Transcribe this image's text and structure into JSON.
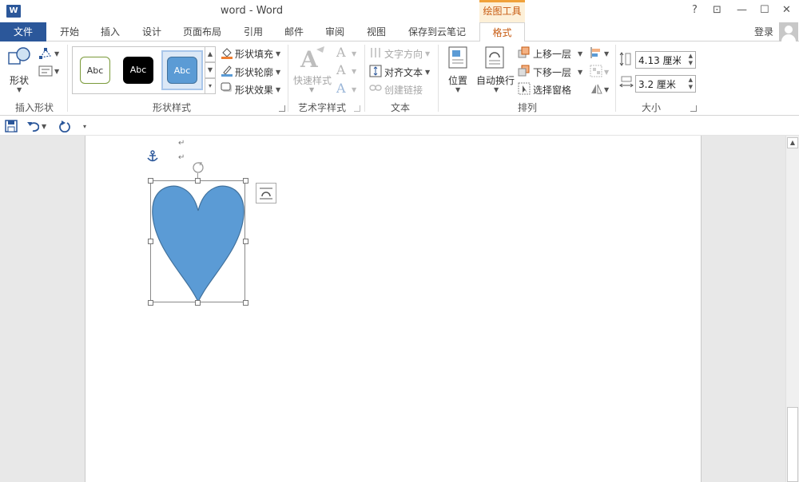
{
  "window": {
    "title": "word - Word",
    "contextual_tab_group": "绘图工具",
    "controls": {
      "help": "?",
      "restore_ribbon": "⊡",
      "minimize": "—",
      "maximize": "☐",
      "close": "✕"
    }
  },
  "tabs": {
    "file": "文件",
    "items": [
      "开始",
      "插入",
      "设计",
      "页面布局",
      "引用",
      "邮件",
      "审阅",
      "视图",
      "保存到云笔记"
    ],
    "active": "格式",
    "login": "登录"
  },
  "ribbon": {
    "insert_shapes": {
      "shapes_label": "形状",
      "group_label": "插入形状"
    },
    "shape_styles": {
      "thumbnails": [
        "Abc",
        "Abc",
        "Abc"
      ],
      "fill": "形状填充",
      "outline": "形状轮廓",
      "effects": "形状效果",
      "group_label": "形状样式"
    },
    "wordart": {
      "quick_styles": "快速样式",
      "group_label": "艺术字样式"
    },
    "text": {
      "direction": "文字方向",
      "align": "对齐文本",
      "link": "创建链接",
      "group_label": "文本"
    },
    "arrange": {
      "position": "位置",
      "wrap": "自动换行",
      "bring_forward": "上移一层",
      "send_backward": "下移一层",
      "selection_pane": "选择窗格",
      "group_label": "排列"
    },
    "size": {
      "height": "4.13 厘米",
      "width": "3.2 厘米",
      "group_label": "大小"
    }
  },
  "colors": {
    "accent": "#2b579a",
    "contextual": "#c75b12",
    "heart_fill": "#5b9bd5",
    "heart_stroke": "#41719c"
  }
}
